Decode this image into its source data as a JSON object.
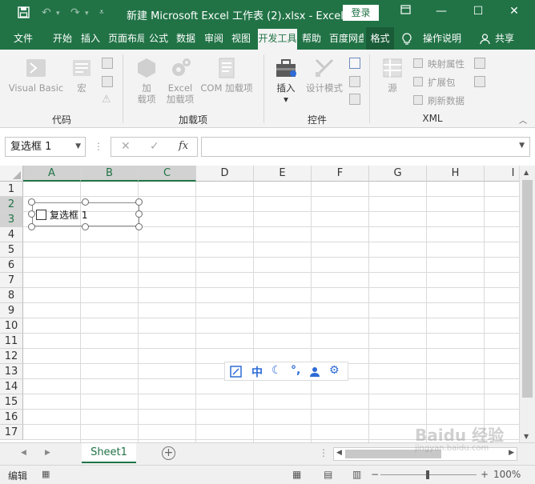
{
  "titlebar": {
    "save_icon": "save-icon",
    "undo_icon": "undo-icon",
    "redo_icon": "redo-icon",
    "customize_icon": "customize-qat-icon",
    "title": "新建 Microsoft Excel 工作表 (2).xlsx  -  Excel",
    "login": "登录",
    "ribbon_display_icon": "ribbon-display-icon",
    "minimize_icon": "minimize-icon",
    "maximize_icon": "maximize-icon",
    "close_icon": "close-icon",
    "accent": "#217346"
  },
  "tabs": [
    {
      "label": "文件"
    },
    {
      "label": "开始"
    },
    {
      "label": "插入"
    },
    {
      "label": "页面布局"
    },
    {
      "label": "公式"
    },
    {
      "label": "数据"
    },
    {
      "label": "审阅"
    },
    {
      "label": "视图"
    },
    {
      "label": "开发工具"
    },
    {
      "label": "帮助"
    },
    {
      "label": "百度网盘"
    },
    {
      "label": "格式"
    }
  ],
  "tabs_right": {
    "tellme_icon": "lightbulb-icon",
    "tellme": "操作说明",
    "share_icon": "share-icon",
    "share": "共享"
  },
  "ribbon": {
    "groups": [
      {
        "name": "代码"
      },
      {
        "name": "加载项"
      },
      {
        "name": "控件"
      },
      {
        "name": "XML"
      }
    ],
    "code": {
      "visual_basic": "Visual Basic",
      "macro": "宏"
    },
    "addins": {
      "addin_line1": "加",
      "addin_line2": "载项",
      "excel_addin_line1": "Excel",
      "excel_addin_line2": "加载项",
      "com_addin": "COM 加载项"
    },
    "controls": {
      "insert": "插入",
      "insert_arrow": "▾",
      "design_mode": "设计模式"
    },
    "xml": {
      "source": "源",
      "map_props": "映射属性",
      "expansion_packs": "扩展包",
      "refresh_data": "刷新数据"
    },
    "collapse_icon": "collapse-ribbon-icon"
  },
  "formula_bar": {
    "name_box": "复选框 1",
    "cancel_glyph": "✕",
    "enter_glyph": "✓",
    "fx_label": "fx",
    "formula": ""
  },
  "grid": {
    "columns": [
      "A",
      "B",
      "C",
      "D",
      "E",
      "F",
      "G",
      "H",
      "I"
    ],
    "selected_columns": [
      "A",
      "B",
      "C"
    ],
    "rows": [
      "1",
      "2",
      "3",
      "4",
      "5",
      "6",
      "7",
      "8",
      "9",
      "10",
      "11",
      "12",
      "13",
      "14",
      "15",
      "16",
      "17"
    ],
    "selected_rows": [
      "2",
      "3"
    ]
  },
  "checkbox_control": {
    "label": "复选框 1",
    "checked": false
  },
  "ime_toolbar": {
    "icons": [
      "ime-settings-square-icon",
      "chinese-mode-icon",
      "moon-icon",
      "punctuation-icon",
      "user-icon",
      "gear-icon"
    ],
    "chinese_label": "中"
  },
  "sheets": {
    "active": "Sheet1",
    "add_icon": "add-sheet-icon"
  },
  "status": {
    "mode": "编辑",
    "zoom": "100%",
    "zoom_level": 1.0
  },
  "watermark": {
    "text": "Baidu 经验",
    "url": "jingyan.baidu.com"
  }
}
